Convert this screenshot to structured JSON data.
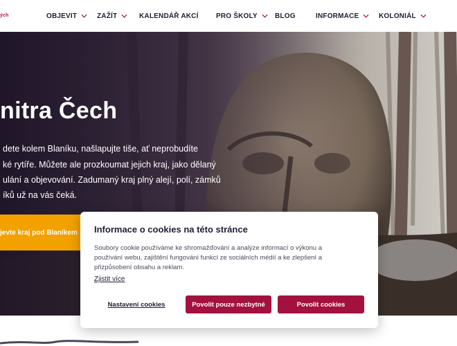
{
  "logo": {
    "fragment": "ých"
  },
  "nav": {
    "items": [
      {
        "label": "OBJEVIT",
        "dropdown": true
      },
      {
        "label": "ZAŽÍT",
        "dropdown": true
      },
      {
        "label": "KALENDÁŘ AKCÍ",
        "dropdown": false
      },
      {
        "label": "PRO ŠKOLY",
        "dropdown": true
      },
      {
        "label": "BLOG",
        "dropdown": false
      },
      {
        "label": "INFORMACE",
        "dropdown": true
      },
      {
        "label": "KOLONIÁL",
        "dropdown": true
      }
    ],
    "chevron_icon": "chevron-down-icon",
    "chevron_color": "#a8174b"
  },
  "hero": {
    "title": "nitra Čech",
    "paragraph_lines": [
      "dete kolem Blaníku, našlapujte tiše, ať neprobudíte",
      "ké rytíře. Můžete ale prozkoumat jejich kraj, jako dělaný",
      "ulání a objevování. Zadumaný kraj plný alejí, polí, zámků",
      "íků už na vás čeká."
    ],
    "cta_label": "jevte kraj pod Blaníkem",
    "cta_color": "#f2a100"
  },
  "cookie": {
    "title": "Informace o cookies na této stránce",
    "text_lines": [
      "Soubory cookie používáme ke shromažďování a analýze informací o výkonu a",
      "používání webu, zajištění fungování funkcí ze sociálních médií a ke zlepšení a",
      "přizpůsobení obsahu a reklam."
    ],
    "more_link": "Zjistit více",
    "settings_button": "Nastavení cookies",
    "necessary_button": "Povolit pouze nezbytné",
    "allow_button": "Povolit cookies",
    "accent_color": "#a3113f"
  }
}
